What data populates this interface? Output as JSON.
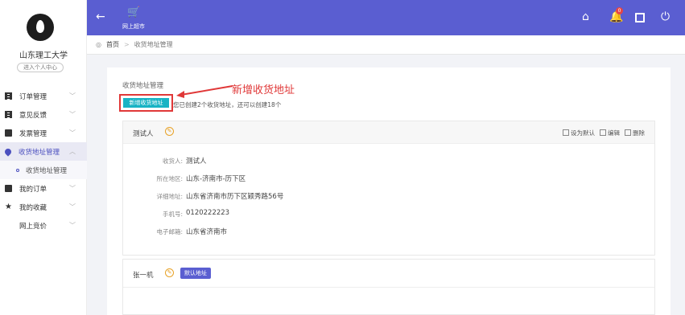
{
  "sidebar": {
    "school_name": "山东理工大学",
    "personal_center": "进入个人中心",
    "items": [
      {
        "label": "订单管理",
        "icon": "list-icon"
      },
      {
        "label": "意见反馈",
        "icon": "list-icon"
      },
      {
        "label": "发票管理",
        "icon": "document-icon"
      },
      {
        "label": "收货地址管理",
        "icon": "location-pin-icon"
      },
      {
        "label": "收货地址管理",
        "icon": "dot-icon"
      },
      {
        "label": "我的订单",
        "icon": "document-icon"
      },
      {
        "label": "我的收藏",
        "icon": "star-icon"
      },
      {
        "label": "网上竞价",
        "icon": ""
      }
    ]
  },
  "topbar": {
    "shop_label": "网上超市",
    "notification_count": "0",
    "brand_color": "#5a5ed1"
  },
  "breadcrumb": {
    "home": "首页",
    "current": "收货地址管理"
  },
  "content": {
    "section_title": "收货地址管理",
    "add_button": "新增收货地址",
    "hint": "您已创建2个收货地址，还可以创建18个",
    "annotation": "新增收货地址",
    "actions": {
      "set_default": "设为默认",
      "edit": "编辑",
      "delete": "删除"
    },
    "card1": {
      "name": "测试人",
      "fields": [
        {
          "label": "收货人:",
          "value": "测试人"
        },
        {
          "label": "所在地区:",
          "value": "山东-济南市-历下区"
        },
        {
          "label": "详细地址:",
          "value": "山东省济南市历下区颖秀路56号"
        },
        {
          "label": "手机号:",
          "value": "0120222223"
        },
        {
          "label": "电子邮箱:",
          "value": "山东省济南市"
        }
      ]
    },
    "card2": {
      "name": "张一机",
      "default_tag": "默认地址"
    }
  }
}
